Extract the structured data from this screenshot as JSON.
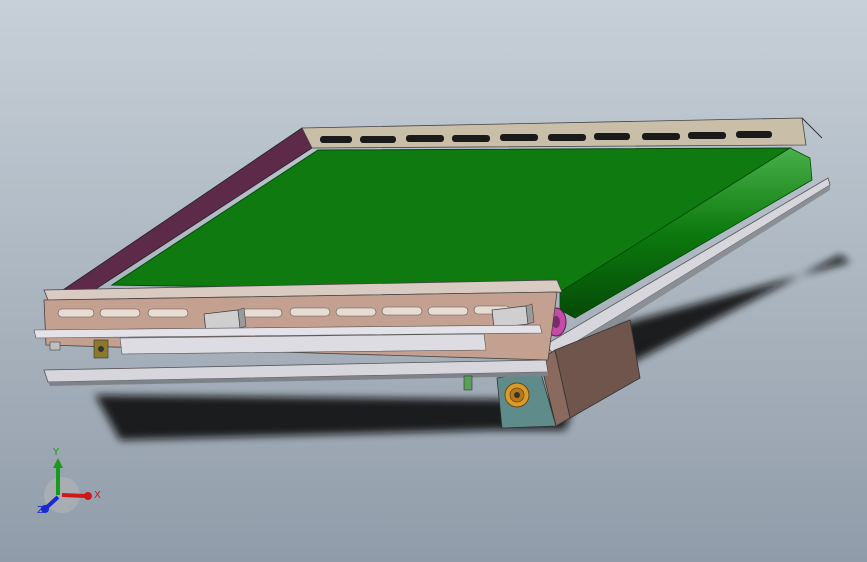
{
  "viewport": {
    "background_top": "#c7d0d8",
    "background_bottom": "#909ca9"
  },
  "model": {
    "belt_color": "#0e7a10",
    "side_rail_color": "#5e2a4a",
    "frame_color": "#c4a090",
    "end_plate_color": "#c9bfa9",
    "rail_color": "#d6d6dc",
    "motor_color": "#7b5c52",
    "gear_color": "#d99b2b",
    "roller_cap_color": "#c34ca6"
  },
  "triad": {
    "x_label": "X",
    "y_label": "Y",
    "z_label": "Z",
    "x_color": "#d01818",
    "y_color": "#1a9a1a",
    "z_color": "#1a2ad0"
  }
}
